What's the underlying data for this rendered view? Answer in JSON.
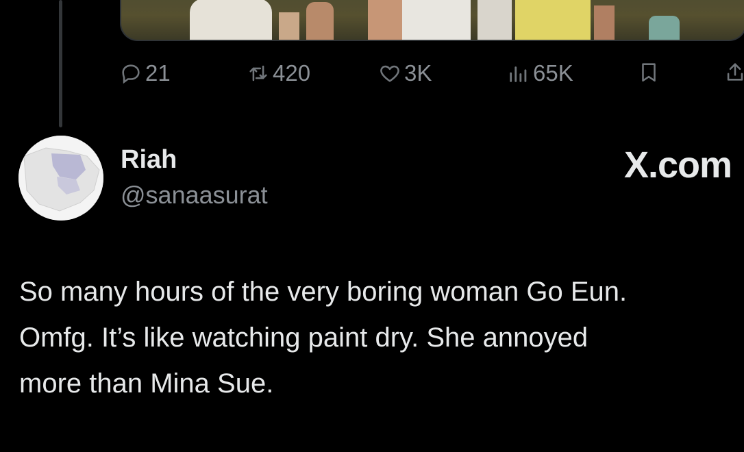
{
  "tweet_actions": {
    "replies": "21",
    "reposts": "420",
    "likes": "3K",
    "views": "65K",
    "icons": [
      "reply-icon",
      "repost-icon",
      "like-icon",
      "views-icon",
      "bookmark-icon",
      "share-icon"
    ]
  },
  "reply": {
    "display_name": "Riah",
    "handle": "@sanaasurat",
    "brand": "X.com",
    "text_lines": [
      "So many hours of the very boring woman Go Eun.",
      "Omfg. It’s like watching paint dry. She annoyed",
      "more than Mina Sue."
    ]
  },
  "colors": {
    "background": "#000000",
    "primary_text": "#e7e9ea",
    "secondary_text": "#71767b",
    "border": "#2f3336"
  }
}
